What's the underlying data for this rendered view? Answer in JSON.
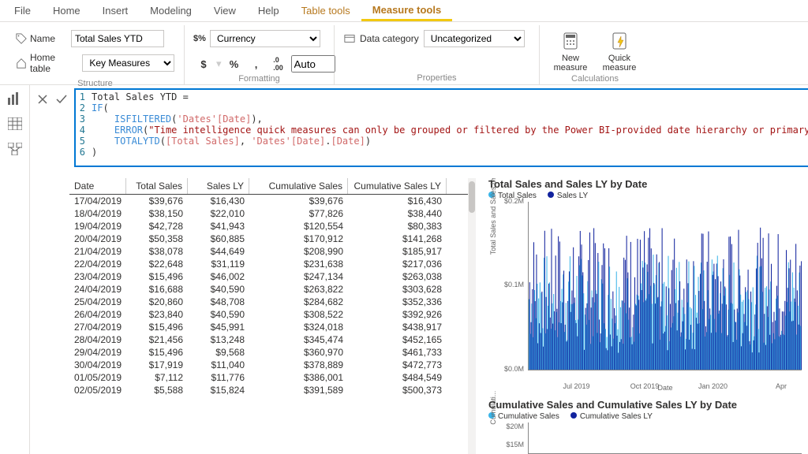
{
  "menu": {
    "items": [
      "File",
      "Home",
      "Insert",
      "Modeling",
      "View",
      "Help",
      "Table tools",
      "Measure tools"
    ],
    "active": "Measure tools",
    "tools": [
      "Table tools",
      "Measure tools"
    ]
  },
  "ribbon": {
    "structure": {
      "group_label": "Structure",
      "name_label": "Name",
      "name_value": "Total Sales YTD",
      "home_table_label": "Home table",
      "home_table_value": "Key Measures"
    },
    "formatting": {
      "group_label": "Formatting",
      "format_value": "Currency",
      "decimals_value": "Auto",
      "btn_dollar": "$",
      "btn_percent": "%",
      "btn_comma": ","
    },
    "properties": {
      "group_label": "Properties",
      "data_category_label": "Data category",
      "data_category_value": "Uncategorized"
    },
    "calculations": {
      "group_label": "Calculations",
      "new_measure": "New\nmeasure",
      "quick_measure": "Quick\nmeasure"
    }
  },
  "formula": {
    "lines": [
      "Total Sales YTD =",
      "IF(",
      "    ISFILTERED('Dates'[Date]),",
      "    ERROR(\"Time intelligence quick measures can only be grouped or filtered by the Power BI-provided date hierarchy or primary date column.\"),",
      "    TOTALYTD([Total Sales], 'Dates'[Date].[Date])",
      ")"
    ]
  },
  "table": {
    "headers": [
      "Date",
      "Total Sales",
      "Sales LY",
      "Cumulative Sales",
      "Cumulative Sales LY"
    ],
    "rows": [
      [
        "17/04/2019",
        "$39,676",
        "$16,430",
        "$39,676",
        "$16,430"
      ],
      [
        "18/04/2019",
        "$38,150",
        "$22,010",
        "$77,826",
        "$38,440"
      ],
      [
        "19/04/2019",
        "$42,728",
        "$41,943",
        "$120,554",
        "$80,383"
      ],
      [
        "20/04/2019",
        "$50,358",
        "$60,885",
        "$170,912",
        "$141,268"
      ],
      [
        "21/04/2019",
        "$38,078",
        "$44,649",
        "$208,990",
        "$185,917"
      ],
      [
        "22/04/2019",
        "$22,648",
        "$31,119",
        "$231,638",
        "$217,036"
      ],
      [
        "23/04/2019",
        "$15,496",
        "$46,002",
        "$247,134",
        "$263,038"
      ],
      [
        "24/04/2019",
        "$16,688",
        "$40,590",
        "$263,822",
        "$303,628"
      ],
      [
        "25/04/2019",
        "$20,860",
        "$48,708",
        "$284,682",
        "$352,336"
      ],
      [
        "26/04/2019",
        "$23,840",
        "$40,590",
        "$308,522",
        "$392,926"
      ],
      [
        "27/04/2019",
        "$15,496",
        "$45,991",
        "$324,018",
        "$438,917"
      ],
      [
        "28/04/2019",
        "$21,456",
        "$13,248",
        "$345,474",
        "$452,165"
      ],
      [
        "29/04/2019",
        "$15,496",
        "$9,568",
        "$360,970",
        "$461,733"
      ],
      [
        "30/04/2019",
        "$17,919",
        "$11,040",
        "$378,889",
        "$472,773"
      ],
      [
        "01/05/2019",
        "$7,112",
        "$11,776",
        "$386,001",
        "$484,549"
      ],
      [
        "02/05/2019",
        "$5,588",
        "$15,824",
        "$391,589",
        "$500,373"
      ]
    ]
  },
  "chart1": {
    "title": "Total Sales and Sales LY by Date",
    "legend": [
      {
        "name": "Total Sales",
        "color": "#3ab4e8"
      },
      {
        "name": "Sales LY",
        "color": "#12239e"
      }
    ],
    "y_title": "Total Sales and Sales LY",
    "x_title": "Date",
    "y_ticks": [
      "$0.2M",
      "$0.1M",
      "$0.0M"
    ],
    "x_ticks": [
      "Jul 2019",
      "Oct 2019",
      "Jan 2020",
      "Apr"
    ]
  },
  "chart2": {
    "title": "Cumulative Sales and Cumulative Sales LY by Date",
    "legend": [
      {
        "name": "Cumulative Sales",
        "color": "#3ab4e8"
      },
      {
        "name": "Cumulative Sales LY",
        "color": "#12239e"
      }
    ],
    "y_title": "Cumulati...",
    "y_ticks": [
      "$20M",
      "$15M"
    ]
  },
  "chart_data": [
    {
      "type": "bar",
      "title": "Total Sales and Sales LY by Date",
      "xlabel": "Date",
      "ylabel": "Total Sales and Sales LY",
      "ylim": [
        0,
        200000
      ],
      "x_range": [
        "2019-04",
        "2020-04"
      ],
      "series": [
        {
          "name": "Total Sales",
          "color": "#3ab4e8",
          "approx_range": [
            5000,
            120000
          ]
        },
        {
          "name": "Sales LY",
          "color": "#12239e",
          "approx_range": [
            5000,
            150000
          ]
        }
      ],
      "note": "Daily clustered columns roughly between $5K and $150K; values not individually labeled."
    },
    {
      "type": "area",
      "title": "Cumulative Sales and Cumulative Sales LY by Date",
      "ylabel": "Cumulative",
      "ylim": [
        0,
        20000000
      ],
      "series": [
        {
          "name": "Cumulative Sales",
          "color": "#3ab4e8"
        },
        {
          "name": "Cumulative Sales LY",
          "color": "#12239e"
        }
      ],
      "note": "Only top of chart visible; y-axis shows $20M and $15M gridlines."
    }
  ]
}
